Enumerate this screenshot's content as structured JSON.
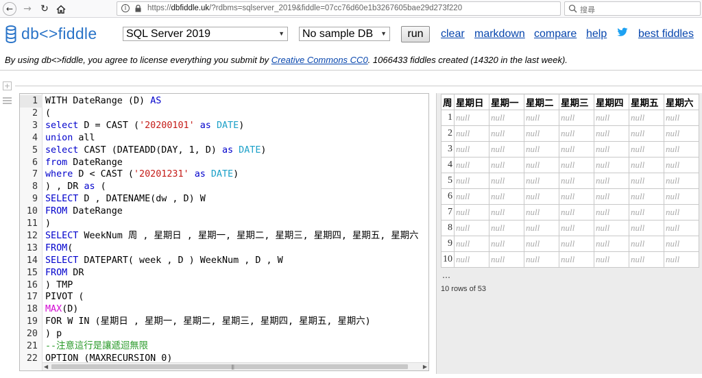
{
  "browser": {
    "url_scheme": "https://",
    "url_host": "dbfiddle.uk",
    "url_path": "/?rdbms=sqlserver_2019&fiddle=07cc76d60e1b3267605bae29d273f220",
    "search_placeholder": "搜尋",
    "url_menu": "•••"
  },
  "header": {
    "logo_text": "db<>fiddle",
    "dbms_selected": "SQL Server 2019",
    "sample_selected": "No sample DB",
    "run_label": "run",
    "links": {
      "clear": "clear",
      "markdown": "markdown",
      "compare": "compare",
      "help": "help",
      "best": "best fiddles"
    },
    "brand_color": "#2a74c8",
    "link_color": "#0645ad"
  },
  "license": {
    "prefix": "By using db<>fiddle, you agree to license everything you submit by ",
    "link": "Creative Commons CC0",
    "suffix": ". 1066433 fiddles created (14320 in the last week)."
  },
  "editor": {
    "lines": [
      {
        "n": "1",
        "t": [
          [
            "tx",
            "WITH DateRange (D) "
          ],
          [
            "kw",
            "AS"
          ]
        ]
      },
      {
        "n": "2",
        "t": [
          [
            "tx",
            "("
          ]
        ]
      },
      {
        "n": "3",
        "t": [
          [
            "kw",
            "select"
          ],
          [
            "tx",
            " D = CAST ("
          ],
          [
            "str",
            "'20200101'"
          ],
          [
            "tx",
            " "
          ],
          [
            "kw",
            "as"
          ],
          [
            "tx",
            " "
          ],
          [
            "ty",
            "DATE"
          ],
          [
            "tx",
            ")"
          ]
        ]
      },
      {
        "n": "4",
        "t": [
          [
            "kw",
            "union"
          ],
          [
            "tx",
            " all"
          ]
        ]
      },
      {
        "n": "5",
        "t": [
          [
            "kw",
            "select"
          ],
          [
            "tx",
            " CAST (DATEADD(DAY, 1, D) "
          ],
          [
            "kw",
            "as"
          ],
          [
            "tx",
            " "
          ],
          [
            "ty",
            "DATE"
          ],
          [
            "tx",
            ")"
          ]
        ]
      },
      {
        "n": "6",
        "t": [
          [
            "kw",
            "from"
          ],
          [
            "tx",
            " DateRange"
          ]
        ]
      },
      {
        "n": "7",
        "t": [
          [
            "kw",
            "where"
          ],
          [
            "tx",
            " D < CAST ("
          ],
          [
            "str",
            "'20201231'"
          ],
          [
            "tx",
            " "
          ],
          [
            "kw",
            "as"
          ],
          [
            "tx",
            " "
          ],
          [
            "ty",
            "DATE"
          ],
          [
            "tx",
            ")"
          ]
        ]
      },
      {
        "n": "8",
        "t": [
          [
            "tx",
            ") , DR "
          ],
          [
            "kw",
            "as"
          ],
          [
            "tx",
            " ("
          ]
        ]
      },
      {
        "n": "9",
        "t": [
          [
            "kw",
            "SELECT"
          ],
          [
            "tx",
            " D , DATENAME(dw , D) W"
          ]
        ]
      },
      {
        "n": "10",
        "t": [
          [
            "kw",
            "FROM"
          ],
          [
            "tx",
            " DateRange"
          ]
        ]
      },
      {
        "n": "11",
        "t": [
          [
            "tx",
            ")"
          ]
        ]
      },
      {
        "n": "12",
        "t": [
          [
            "kw",
            "SELECT"
          ],
          [
            "tx",
            " WeekNum 周 , 星期日 , 星期一, 星期二, 星期三, 星期四, 星期五, 星期六"
          ]
        ]
      },
      {
        "n": "13",
        "t": [
          [
            "kw",
            "FROM"
          ],
          [
            "tx",
            "("
          ]
        ]
      },
      {
        "n": "14",
        "t": [
          [
            "kw",
            "SELECT"
          ],
          [
            "tx",
            " DATEPART( week , D ) WeekNum , D , W"
          ]
        ]
      },
      {
        "n": "15",
        "t": [
          [
            "kw",
            "FROM"
          ],
          [
            "tx",
            " DR"
          ]
        ]
      },
      {
        "n": "16",
        "t": [
          [
            "tx",
            ") TMP"
          ]
        ]
      },
      {
        "n": "17",
        "t": [
          [
            "tx",
            "PIVOT ("
          ]
        ]
      },
      {
        "n": "18",
        "t": [
          [
            "mx",
            "MAX"
          ],
          [
            "tx",
            "(D)"
          ]
        ]
      },
      {
        "n": "19",
        "t": [
          [
            "tx",
            "FOR W IN (星期日 , 星期一, 星期二, 星期三, 星期四, 星期五, 星期六)"
          ]
        ]
      },
      {
        "n": "20",
        "t": [
          [
            "tx",
            ") p"
          ]
        ]
      },
      {
        "n": "21",
        "t": [
          [
            "cm",
            "--注意這行是讓遞迴無限"
          ]
        ]
      },
      {
        "n": "22",
        "t": [
          [
            "tx",
            "OPTION (MAXRECURSION 0)"
          ]
        ]
      }
    ]
  },
  "result": {
    "columns": [
      "周",
      "星期日",
      "星期一",
      "星期二",
      "星期三",
      "星期四",
      "星期五",
      "星期六"
    ],
    "rows": [
      [
        "1",
        "null",
        "null",
        "null",
        "null",
        "null",
        "null",
        "null"
      ],
      [
        "2",
        "null",
        "null",
        "null",
        "null",
        "null",
        "null",
        "null"
      ],
      [
        "3",
        "null",
        "null",
        "null",
        "null",
        "null",
        "null",
        "null"
      ],
      [
        "4",
        "null",
        "null",
        "null",
        "null",
        "null",
        "null",
        "null"
      ],
      [
        "5",
        "null",
        "null",
        "null",
        "null",
        "null",
        "null",
        "null"
      ],
      [
        "6",
        "null",
        "null",
        "null",
        "null",
        "null",
        "null",
        "null"
      ],
      [
        "7",
        "null",
        "null",
        "null",
        "null",
        "null",
        "null",
        "null"
      ],
      [
        "8",
        "null",
        "null",
        "null",
        "null",
        "null",
        "null",
        "null"
      ],
      [
        "9",
        "null",
        "null",
        "null",
        "null",
        "null",
        "null",
        "null"
      ],
      [
        "10",
        "null",
        "null",
        "null",
        "null",
        "null",
        "null",
        "null"
      ]
    ],
    "ellipsis": "…",
    "row_count": "10 rows of 53"
  }
}
